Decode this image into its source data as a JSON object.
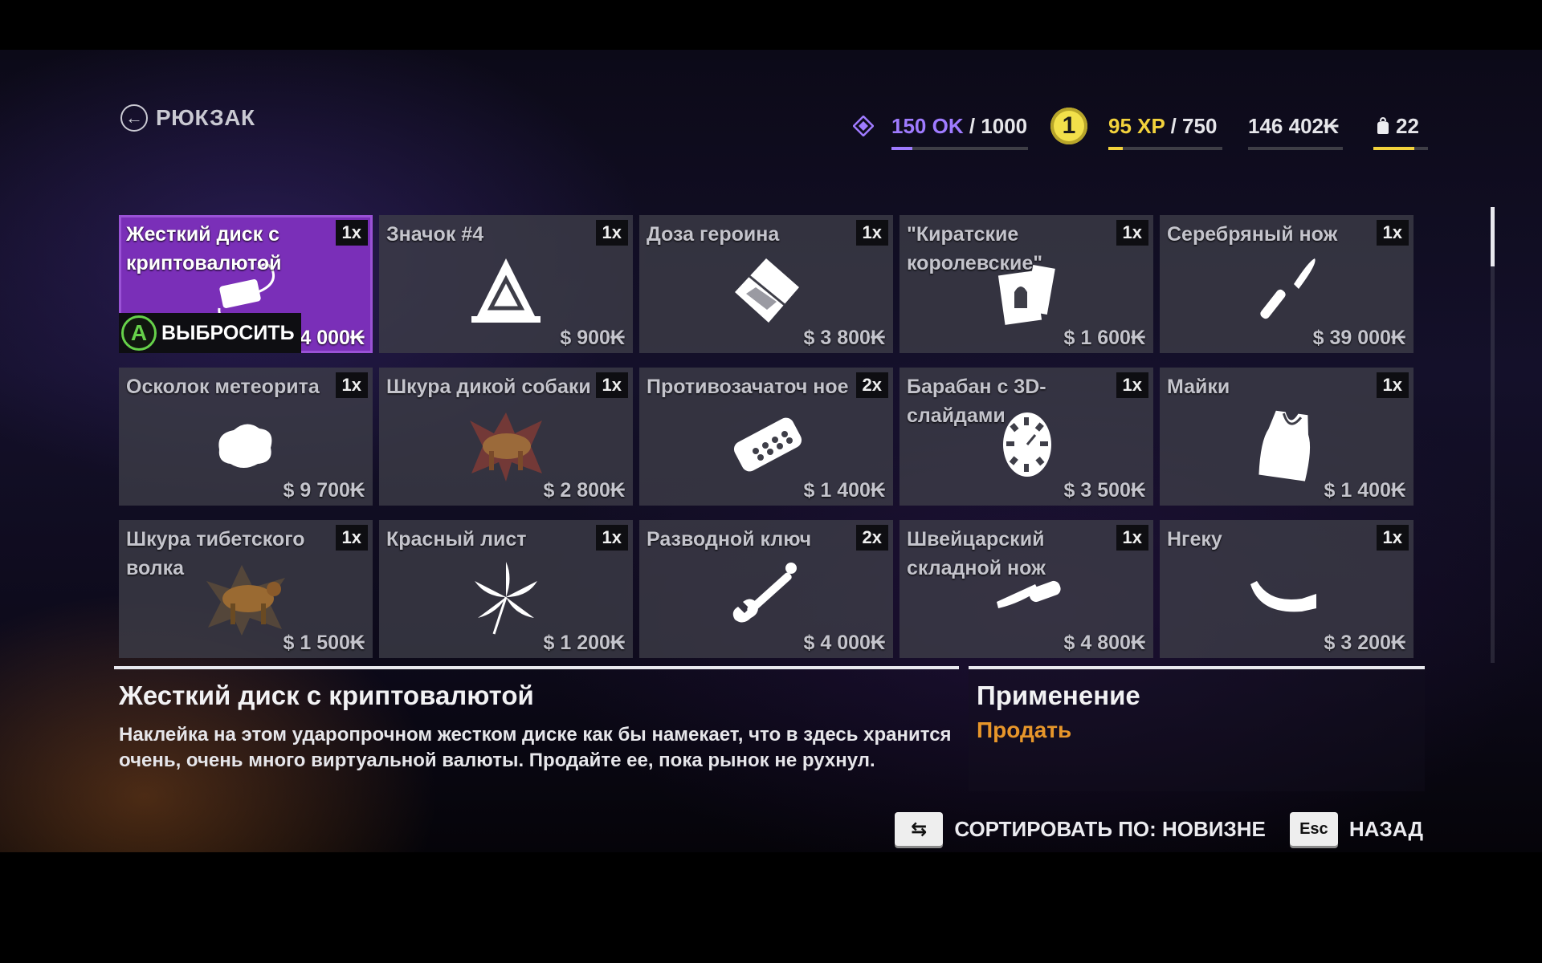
{
  "header": {
    "back_arrow": "←",
    "title": "РЮКЗАК"
  },
  "stats": {
    "ok_value": "150 OK",
    "ok_max": "/ 1000",
    "ok_progress": 0.15,
    "level": "1",
    "xp_value": "95 XP",
    "xp_max": "/ 750",
    "xp_progress": 0.127,
    "money": "146 402₭",
    "bag_count": "22",
    "bag_progress": 0.75,
    "colors": {
      "ok": "#9f7bff",
      "xp": "#f2d23c",
      "bag": "#f2d23c"
    }
  },
  "items": [
    {
      "name": "Жесткий диск с криптовалютой",
      "qty": "1x",
      "price": "34 000₭",
      "icon": "hard-drive-icon",
      "selected": true
    },
    {
      "name": "Значок #4",
      "qty": "1x",
      "price": "$ 900₭",
      "icon": "badge-icon"
    },
    {
      "name": "Доза героина",
      "qty": "1x",
      "price": "$ 3 800₭",
      "icon": "powder-bag-icon"
    },
    {
      "name": "\"Киратские королевские\"",
      "qty": "1x",
      "price": "$ 1 600₭",
      "icon": "cigarette-pack-icon"
    },
    {
      "name": "Серебряный нож",
      "qty": "1x",
      "price": "$ 39 000₭",
      "icon": "knife-icon"
    },
    {
      "name": "Осколок метеорита",
      "qty": "1x",
      "price": "$ 9 700₭",
      "icon": "meteorite-icon"
    },
    {
      "name": "Шкура дикой собаки",
      "qty": "1x",
      "price": "$ 2 800₭",
      "icon": "dog-pelt-icon"
    },
    {
      "name": "Противозачаточ ное",
      "qty": "2x",
      "price": "$ 1 400₭",
      "icon": "pill-pack-icon"
    },
    {
      "name": "Барабан с 3D-слайдами",
      "qty": "1x",
      "price": "$ 3 500₭",
      "icon": "slide-reel-icon"
    },
    {
      "name": "Майки",
      "qty": "1x",
      "price": "$ 1 400₭",
      "icon": "tank-top-icon"
    },
    {
      "name": "Шкура тибетского волка",
      "qty": "1x",
      "price": "$ 1 500₭",
      "icon": "wolf-pelt-icon"
    },
    {
      "name": "Красный лист",
      "qty": "1x",
      "price": "$ 1 200₭",
      "icon": "leaf-icon"
    },
    {
      "name": "Разводной ключ",
      "qty": "2x",
      "price": "$ 4 000₭",
      "icon": "wrench-icon"
    },
    {
      "name": "Швейцарский складной нож",
      "qty": "1x",
      "price": "$ 4 800₭",
      "icon": "folding-knife-icon"
    },
    {
      "name": "Нгеку",
      "qty": "1x",
      "price": "$ 3 200₭",
      "icon": "horn-icon"
    }
  ],
  "drop": {
    "button": "A",
    "label": "ВЫБРОСИТЬ"
  },
  "details": {
    "title": "Жесткий диск с криптовалютой",
    "body": "Наклейка на этом ударопрочном жестком диске как бы намекает, что в здесь хранится очень, очень много виртуальной валюты. Продайте ее, пока рынок не рухнул."
  },
  "usage": {
    "title": "Применение",
    "action": "Продать"
  },
  "footer": {
    "sort_key": "⇆",
    "sort_label": "СОРТИРОВАТЬ ПО: НОВИЗНЕ",
    "back_key": "Esc",
    "back_label": "НАЗАД"
  }
}
